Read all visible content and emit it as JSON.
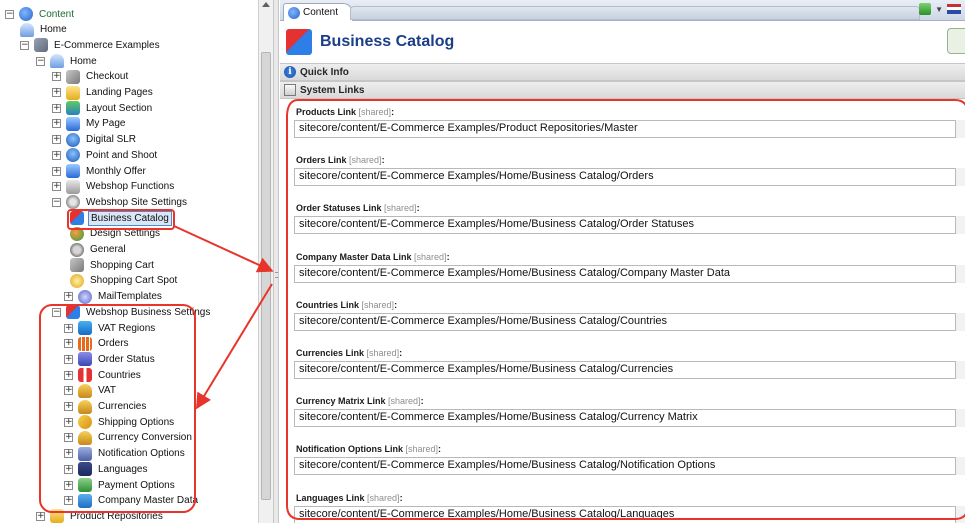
{
  "tree": {
    "items": [
      {
        "label": "Content",
        "toggle": "⊟",
        "icon": "content-icon",
        "depth": 0
      },
      {
        "label": "Home",
        "toggle": "",
        "icon": "home-icon",
        "depth": 1
      },
      {
        "label": "E-Commerce Examples",
        "toggle": "⊟",
        "icon": "ecommerce-icon",
        "depth": 1
      },
      {
        "label": "Home",
        "toggle": "⊟",
        "icon": "home-icon",
        "depth": 2
      },
      {
        "label": "Checkout",
        "toggle": "⊞",
        "icon": "cart-icon",
        "depth": 3
      },
      {
        "label": "Landing Pages",
        "toggle": "⊞",
        "icon": "folder-icon",
        "depth": 3
      },
      {
        "label": "Layout Section",
        "toggle": "⊞",
        "icon": "layout-icon",
        "depth": 3
      },
      {
        "label": "My Page",
        "toggle": "⊞",
        "icon": "page-icon",
        "depth": 3
      },
      {
        "label": "Digital SLR",
        "toggle": "⊞",
        "icon": "disk-icon",
        "depth": 3
      },
      {
        "label": "Point and Shoot",
        "toggle": "⊞",
        "icon": "disk-icon",
        "depth": 3
      },
      {
        "label": "Monthly Offer",
        "toggle": "⊞",
        "icon": "page-icon",
        "depth": 3
      },
      {
        "label": "Webshop Functions",
        "toggle": "⊞",
        "icon": "functions-icon",
        "depth": 3
      },
      {
        "label": "Webshop Site Settings",
        "toggle": "⊟",
        "icon": "settings-icon",
        "depth": 3
      },
      {
        "label": "Business Catalog",
        "toggle": "",
        "icon": "catalog-icon",
        "depth": 4,
        "selected": true
      },
      {
        "label": "Design Settings",
        "toggle": "",
        "icon": "design-icon",
        "depth": 4
      },
      {
        "label": "General",
        "toggle": "",
        "icon": "general-icon",
        "depth": 4
      },
      {
        "label": "Shopping Cart",
        "toggle": "",
        "icon": "cart-icon",
        "depth": 4
      },
      {
        "label": "Shopping Cart Spot",
        "toggle": "",
        "icon": "spot-icon",
        "depth": 4
      },
      {
        "label": "MailTemplates",
        "toggle": "⊞",
        "icon": "mail-icon",
        "depth": 3.5
      },
      {
        "label": "Webshop Business Settings",
        "toggle": "⊟",
        "icon": "catalog-icon",
        "depth": 3
      },
      {
        "label": "VAT Regions",
        "toggle": "⊞",
        "icon": "vat-regions-icon",
        "depth": 3.5
      },
      {
        "label": "Orders",
        "toggle": "⊞",
        "icon": "orders-icon",
        "depth": 3.5
      },
      {
        "label": "Order Status",
        "toggle": "⊞",
        "icon": "status-icon",
        "depth": 3.5
      },
      {
        "label": "Countries",
        "toggle": "⊞",
        "icon": "countries-icon",
        "depth": 3.5
      },
      {
        "label": "VAT",
        "toggle": "⊞",
        "icon": "vat-icon",
        "depth": 3.5
      },
      {
        "label": "Currencies",
        "toggle": "⊞",
        "icon": "currencies-icon",
        "depth": 3.5
      },
      {
        "label": "Shipping Options",
        "toggle": "⊞",
        "icon": "shipping-icon",
        "depth": 3.5
      },
      {
        "label": "Currency Conversion",
        "toggle": "⊞",
        "icon": "currencies-icon",
        "depth": 3.5
      },
      {
        "label": "Notification Options",
        "toggle": "⊞",
        "icon": "notification-icon",
        "depth": 3.5
      },
      {
        "label": "Languages",
        "toggle": "⊞",
        "icon": "languages-icon",
        "depth": 3.5
      },
      {
        "label": "Payment Options",
        "toggle": "⊞",
        "icon": "payment-icon",
        "depth": 3.5
      },
      {
        "label": "Company Master Data",
        "toggle": "⊞",
        "icon": "company-icon",
        "depth": 3.5
      },
      {
        "label": "Product Repositories",
        "toggle": "⊞",
        "icon": "folder-icon",
        "depth": 2
      }
    ]
  },
  "tab": {
    "label": "Content"
  },
  "header": {
    "title": "Business Catalog"
  },
  "sections": {
    "quick_info": "Quick Info",
    "system_links": "System Links"
  },
  "shared_tag": "[shared]",
  "fields": [
    {
      "label": "Products Link",
      "value": "sitecore/content/E-Commerce Examples/Product Repositories/Master"
    },
    {
      "label": "Orders Link",
      "value": "sitecore/content/E-Commerce Examples/Home/Business Catalog/Orders"
    },
    {
      "label": "Order Statuses Link",
      "value": "sitecore/content/E-Commerce Examples/Home/Business Catalog/Order Statuses"
    },
    {
      "label": "Company Master Data Link",
      "value": "sitecore/content/E-Commerce Examples/Home/Business Catalog/Company Master Data"
    },
    {
      "label": "Countries Link",
      "value": "sitecore/content/E-Commerce Examples/Home/Business Catalog/Countries"
    },
    {
      "label": "Currencies Link",
      "value": "sitecore/content/E-Commerce Examples/Home/Business Catalog/Currencies"
    },
    {
      "label": "Currency Matrix Link",
      "value": "sitecore/content/E-Commerce Examples/Home/Business Catalog/Currency Matrix"
    },
    {
      "label": "Notification Options Link",
      "value": "sitecore/content/E-Commerce Examples/Home/Business Catalog/Notification Options"
    },
    {
      "label": "Languages Link",
      "value": "sitecore/content/E-Commerce Examples/Home/Business Catalog/Languages"
    }
  ],
  "colors": {
    "annotation": "#e8352b",
    "selection": "#d9e6f6",
    "title": "#1c3e86"
  }
}
